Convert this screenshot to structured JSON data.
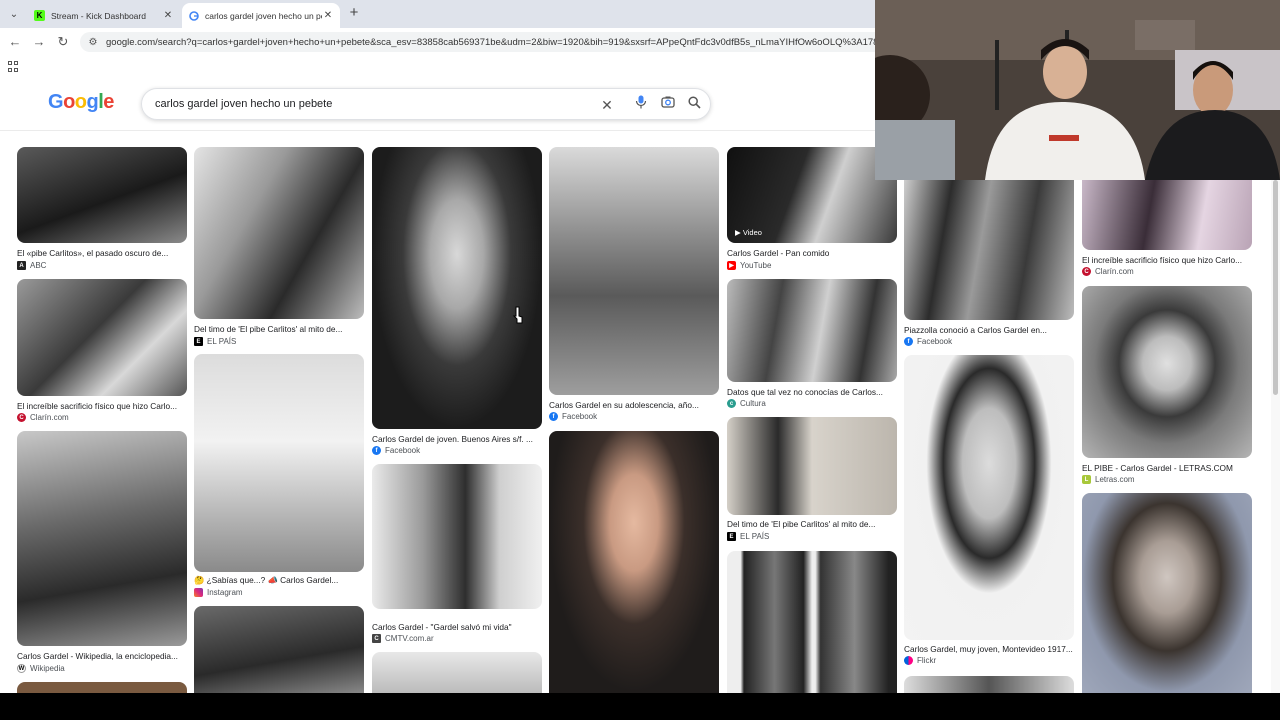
{
  "browser": {
    "tabs": [
      {
        "title": "Stream - Kick Dashboard",
        "favicon": "kick-icon"
      },
      {
        "title": "carlos gardel joven hecho un pe",
        "favicon": "google-icon"
      }
    ],
    "url": "google.com/search?q=carlos+gardel+joven+hecho+un+pebete&sca_esv=83858cab569371be&udm=2&biw=1920&bih=919&sxsrf=APpeQntFdc3v0dfB5s_nLmaYIHfOw6oOLQ%3A1787"
  },
  "search": {
    "logo": "Google",
    "query": "carlos gardel joven hecho un pebete"
  },
  "results": [
    {
      "caption": "El «pibe Carlitos», el pasado oscuro de...",
      "source": "ABC",
      "source_icon": "abc-icon"
    },
    {
      "caption": "El increíble sacrificio físico que hizo Carlo...",
      "source": "Clarín.com",
      "source_icon": "clarin-icon"
    },
    {
      "caption": "Carlos Gardel - Wikipedia, la enciclopedia...",
      "source": "Wikipedia",
      "source_icon": "wikipedia-icon"
    },
    {
      "caption": "Del timo de 'El pibe Carlitos' al mito de...",
      "source": "EL PAÍS",
      "source_icon": "elpais-icon"
    },
    {
      "caption": "🤔 ¿Sabías que...? 📣 Carlos Gardel...",
      "source": "Instagram",
      "source_icon": "instagram-icon"
    },
    {
      "caption": "Carlos Gardel de joven. Buenos Aires s/f. ...",
      "source": "Facebook",
      "source_icon": "facebook-icon"
    },
    {
      "caption": "Carlos Gardel - \"Gardel salvó mi vida\"",
      "source": "CMTV.com.ar",
      "source_icon": "cmtv-icon"
    },
    {
      "caption": "Carlos Gardel en su adolescencia, año...",
      "source": "Facebook",
      "source_icon": "facebook-icon"
    },
    {
      "caption": "Carlos Gardel - Pan comido",
      "source": "YouTube",
      "source_icon": "youtube-icon",
      "badge": "Video"
    },
    {
      "caption": "Datos que tal vez no conocías de Carlos...",
      "source": "Cultura",
      "source_icon": "cultura-icon"
    },
    {
      "caption": "Del timo de 'El pibe Carlitos' al mito de...",
      "source": "EL PAÍS",
      "source_icon": "elpais-icon"
    },
    {
      "caption": "Piazzolla conoció a Carlos Gardel en...",
      "source": "Facebook",
      "source_icon": "facebook-icon"
    },
    {
      "caption": "Carlos Gardel, muy joven, Montevideo 1917...",
      "source": "Flickr",
      "source_icon": "flickr-icon"
    },
    {
      "caption": "El increíble sacrificio físico que hizo Carlo...",
      "source": "Clarín.com",
      "source_icon": "clarin-icon"
    },
    {
      "caption": "EL PIBE - Carlos Gardel - LETRAS.COM",
      "source": "Letras.com",
      "source_icon": "letras-icon"
    }
  ]
}
